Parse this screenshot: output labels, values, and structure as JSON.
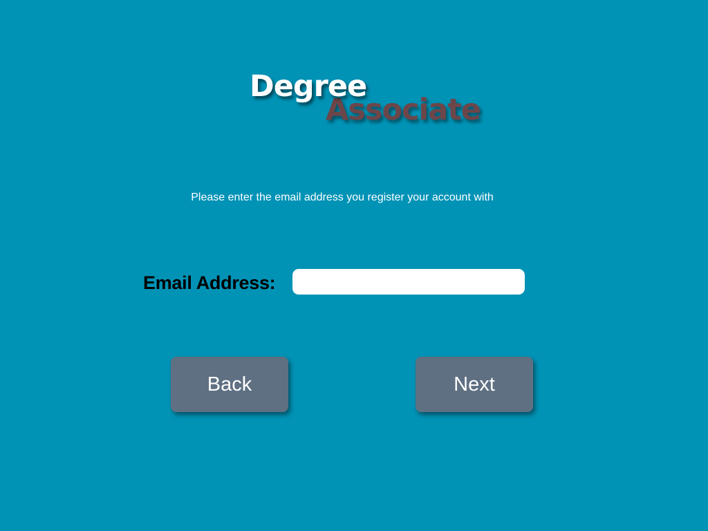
{
  "logo": {
    "line1": "Degree",
    "line2": "Associate",
    "line1_color": "#ffffff",
    "line2_color": "#6d464a"
  },
  "instruction": "Please enter the email address you register your account with",
  "form": {
    "email_label": "Email Address:",
    "email_value": "",
    "email_placeholder": ""
  },
  "buttons": {
    "back_label": "Back",
    "next_label": "Next",
    "color": "#5f7083"
  },
  "theme": {
    "background": "#0093b6"
  }
}
